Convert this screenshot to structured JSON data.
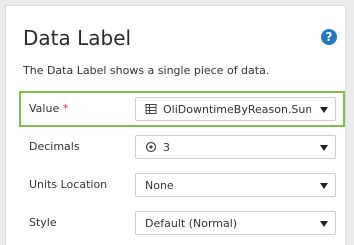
{
  "panel": {
    "title": "Data Label",
    "help_icon": "?",
    "description": "The Data Label shows a single piece of data."
  },
  "fields": {
    "value": {
      "label": "Value",
      "required_mark": "*",
      "selected": "OliDowntimeByReason.SumDowntime",
      "icon": "table-icon"
    },
    "decimals": {
      "label": "Decimals",
      "selected": "3",
      "icon": "target-icon"
    },
    "units_location": {
      "label": "Units Location",
      "selected": "None"
    },
    "style": {
      "label": "Style",
      "selected": "Default (Normal)"
    }
  },
  "colors": {
    "highlight": "#7dc242",
    "help_icon": "#1f78c6",
    "required": "#d9232d"
  }
}
